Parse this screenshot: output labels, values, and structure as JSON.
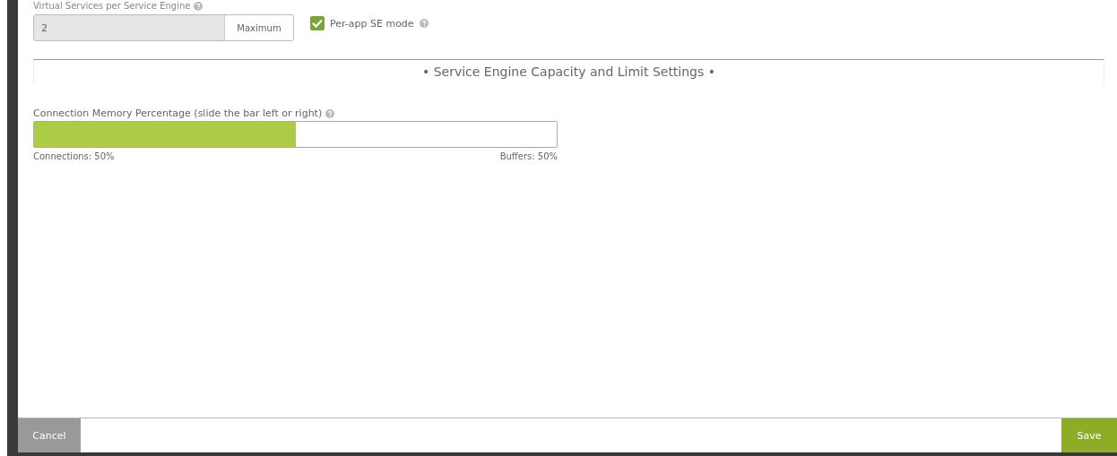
{
  "vs_per_se": {
    "label": "Virtual Services per Service Engine",
    "value": "2",
    "addon": "Maximum"
  },
  "per_app": {
    "label": "Per-app SE mode",
    "checked": true
  },
  "section": {
    "title": "• Service Engine Capacity and Limit Settings •"
  },
  "memory": {
    "label": "Connection Memory Percentage (slide the bar left or right)",
    "level": 0.5,
    "left_caption": "Connections: 50%",
    "right_caption": "Buffers: 50%"
  },
  "footer": {
    "cancel": "Cancel",
    "save": "Save"
  }
}
